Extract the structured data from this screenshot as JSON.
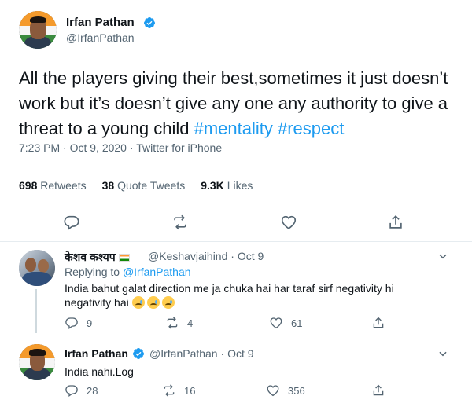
{
  "main_tweet": {
    "author_name": "Irfan Pathan",
    "author_handle": "@IrfanPathan",
    "text_plain": "All the players giving their best,sometimes it just doesn’t work but it’s doesn’t give any one any authority to give a threat to a young child ",
    "hashtags": [
      "#mentality",
      "#respect"
    ],
    "time": "7:23 PM",
    "date": "Oct 9, 2020",
    "source": "Twitter for iPhone",
    "retweets_count": "698",
    "retweets_label": "Retweets",
    "quote_tweets_count": "38",
    "quote_tweets_label": "Quote Tweets",
    "likes_count": "9.3K",
    "likes_label": "Likes"
  },
  "reply_1": {
    "author_name": "केशव कश्यप",
    "author_handle": "@Keshavjaihind",
    "date": "Oct 9",
    "replying_label": "Replying to",
    "replying_to": "@IrfanPathan",
    "text": "India bahut galat direction me ja chuka hai har taraf sirf negativity hi negativity hai",
    "reply_count": "9",
    "retweet_count": "4",
    "like_count": "61"
  },
  "reply_2": {
    "author_name": "Irfan Pathan",
    "author_handle": "@IrfanPathan",
    "date": "Oct 9",
    "text": "India nahi.Log",
    "reply_count": "28",
    "retweet_count": "16",
    "like_count": "356"
  },
  "colors": {
    "accent": "#1d9bf0",
    "muted": "#536471",
    "text": "#0f1419"
  },
  "icons": [
    "verified-badge-icon",
    "reply-icon",
    "retweet-icon",
    "like-icon",
    "share-icon",
    "chevron-down-icon",
    "india-flag-icon",
    "crying-face-emoji"
  ]
}
